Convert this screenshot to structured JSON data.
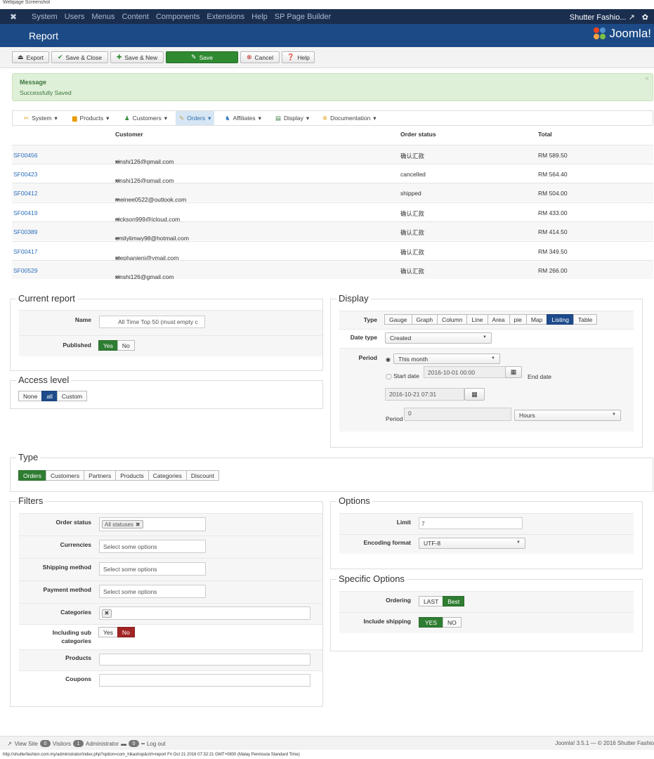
{
  "caption": "Webpage Screenshot",
  "topnav": {
    "items": [
      "System",
      "Users",
      "Menus",
      "Content",
      "Components",
      "Extensions",
      "Help",
      "SP Page Builder"
    ],
    "site": "Shutter Fashio...",
    "gear": "✿"
  },
  "header": {
    "title": "Report",
    "brand": "Joomla!"
  },
  "toolbar": {
    "export": "Export",
    "save_close": "Save & Close",
    "save_new": "Save & New",
    "save": "Save",
    "cancel": "Cancel",
    "help": "Help"
  },
  "message": {
    "heading": "Message",
    "text": "Successfully Saved",
    "close": "×"
  },
  "submenu": [
    "System",
    "Products",
    "Customers",
    "Orders",
    "Affiliates",
    "Display",
    "Documentation"
  ],
  "orders": {
    "headers": {
      "customer": "Customer",
      "status": "Order status",
      "total": "Total"
    },
    "rows": [
      {
        "id": "SF00456",
        "customer": "xinshi126@gmail.com",
        "status": "确认汇款",
        "total": "RM 589.50"
      },
      {
        "id": "SF00423",
        "customer": "xinshi126@gmail.com",
        "status": "cancelled",
        "total": "RM 564.40"
      },
      {
        "id": "SF00412",
        "customer": "meinee0522@outlook.com",
        "status": "shipped",
        "total": "RM 504.00"
      },
      {
        "id": "SF00419",
        "customer": "nickson999@icloud.com",
        "status": "确认汇款",
        "total": "RM 433.00"
      },
      {
        "id": "SF00389",
        "customer": "emilylimwy98@hotmail.com",
        "status": "确认汇款",
        "total": "RM 414.50"
      },
      {
        "id": "SF00417",
        "customer": "stephanieni@ymail.com",
        "status": "确认汇款",
        "total": "RM 349.50"
      },
      {
        "id": "SF00529",
        "customer": "xinshi126@gmail.com",
        "status": "确认汇款",
        "total": "RM 266.00"
      }
    ]
  },
  "current_report": {
    "legend": "Current report",
    "name_label": "Name",
    "name_value": "All Time Top 50 (must empty c",
    "published_label": "Published",
    "yes": "Yes",
    "no": "No"
  },
  "access": {
    "legend": "Access level",
    "options": [
      "None",
      "all",
      "Custom"
    ]
  },
  "display": {
    "legend": "Display",
    "type_label": "Type",
    "types": [
      "Gauge",
      "Graph",
      "Column",
      "Line",
      "Area",
      "pie",
      "Map",
      "Listing",
      "Table"
    ],
    "date_type_label": "Date type",
    "date_type_value": "Created",
    "period_label": "Period",
    "period_value": "This month",
    "start_label": "Start date",
    "start_value": "2016-10-01 00:00",
    "end_label": "End date",
    "end_value": "2016-10-21 07:31",
    "period2_label": "Period",
    "period2_value": "0",
    "unit_value": "Hours"
  },
  "type_section": {
    "legend": "Type",
    "options": [
      "Orders",
      "Customers",
      "Partners",
      "Products",
      "Categories",
      "Discount"
    ]
  },
  "filters": {
    "legend": "Filters",
    "order_status_label": "Order status",
    "order_status_tag": "All statuses",
    "currencies_label": "Currencies",
    "shipping_label": "Shipping method",
    "payment_label": "Payment method",
    "placeholder": "Select some options",
    "categories_label": "Categories",
    "sub_label_1": "Including sub",
    "sub_label_2": "categories",
    "yes": "Yes",
    "no": "No",
    "products_label": "Products",
    "coupons_label": "Coupons"
  },
  "options": {
    "legend": "Options",
    "limit_label": "Limit",
    "limit_value": "7",
    "encoding_label": "Encoding format",
    "encoding_value": "UTF-8"
  },
  "specific": {
    "legend": "Specific Options",
    "ordering_label": "Ordering",
    "last": "LAST",
    "best": "Best",
    "shipping_label": "Include shipping",
    "yes": "YES",
    "no": "NO"
  },
  "footer": {
    "view_site": "View Site",
    "visitors_count": "0",
    "visitors": "Visitors",
    "admin_count": "1",
    "admin": "Administrator",
    "msg_count": "0",
    "logout": "Log out",
    "version": "Joomla! 3.5.1 — © 2016 Shutter Fashio"
  },
  "url_line": "http://shutterfashion.com.my/administrator/index.php?option=com_hikashop&ctrl=report Fri Oct 21 2016 07:32:21 GMT+0800 (Malay Peninsula Standard Time)"
}
